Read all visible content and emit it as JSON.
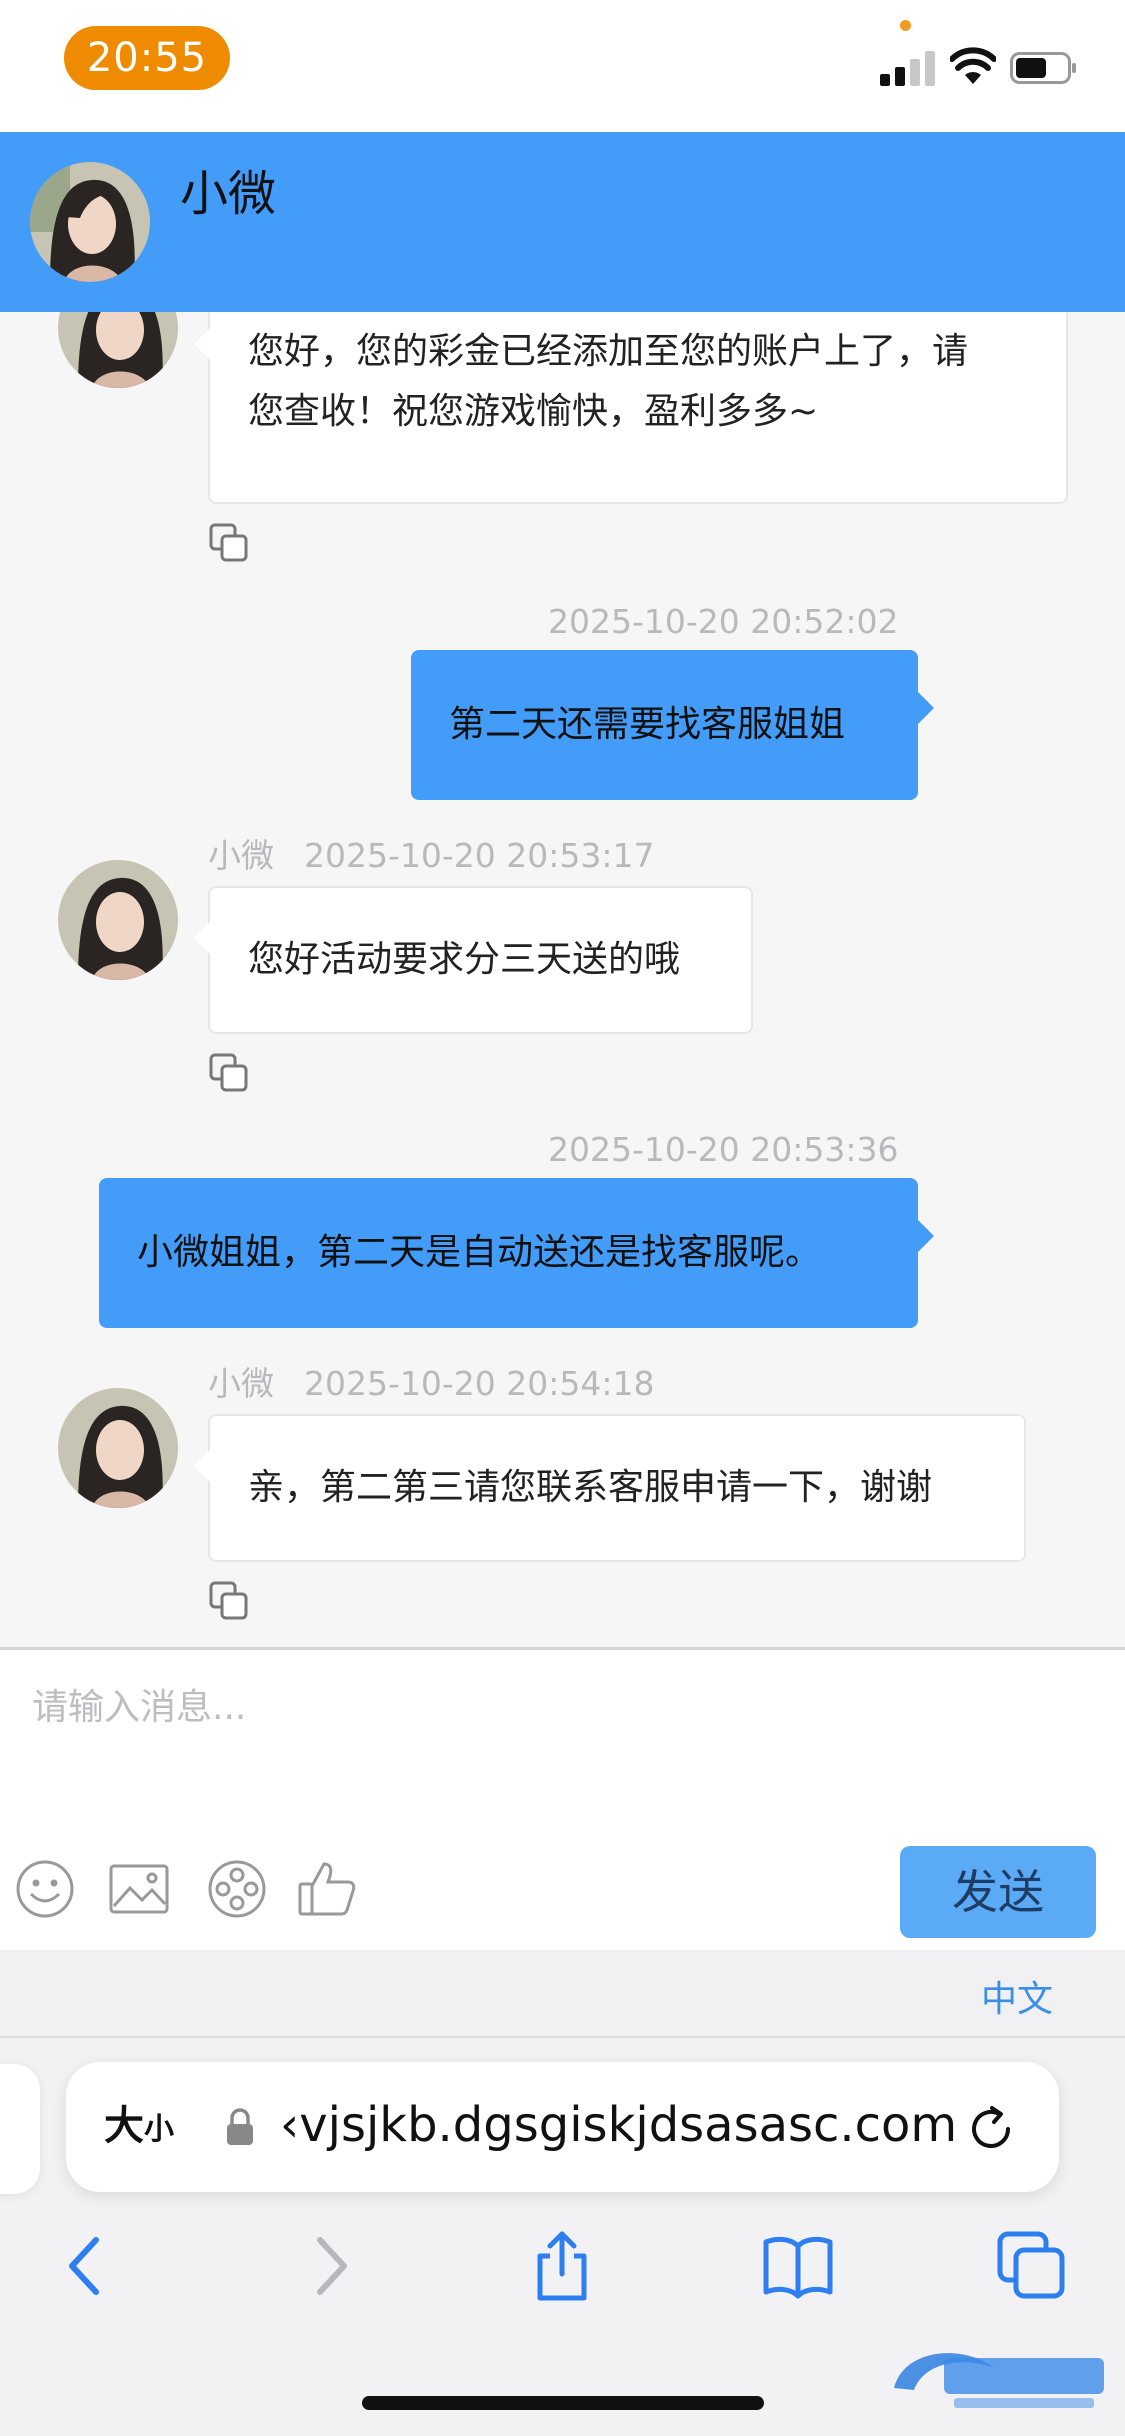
{
  "status_bar": {
    "time": "20:55"
  },
  "header": {
    "contact_name": "小微"
  },
  "messages": [
    {
      "side": "left",
      "text_line1": "您好，您的彩金已经添加至您的账户上了，请",
      "text_line2": "您查收！祝您游戏愉快，盈利多多~"
    },
    {
      "side": "right",
      "timestamp": "2025-10-20 20:52:02",
      "text": "第二天还需要找客服姐姐"
    },
    {
      "side": "left",
      "sender": "小微",
      "timestamp": "2025-10-20 20:53:17",
      "text": "您好活动要求分三天送的哦"
    },
    {
      "side": "right",
      "timestamp": "2025-10-20 20:53:36",
      "text": "小微姐姐，第二天是自动送还是找客服呢。"
    },
    {
      "side": "left",
      "sender": "小微",
      "timestamp": "2025-10-20 20:54:18",
      "text": "亲，第二第三请您联系客服申请一下，谢谢"
    }
  ],
  "composer": {
    "placeholder": "请输入消息...",
    "send_label": "发送"
  },
  "language": {
    "label": "中文"
  },
  "browser": {
    "text_size_big": "大",
    "text_size_small": "小",
    "url": "‹vjsjkb.dgsgiskjdsasasc.com"
  },
  "colors": {
    "header_blue": "#429cf8",
    "time_pill": "#ef8b00",
    "send_button": "#5aaaf6"
  }
}
